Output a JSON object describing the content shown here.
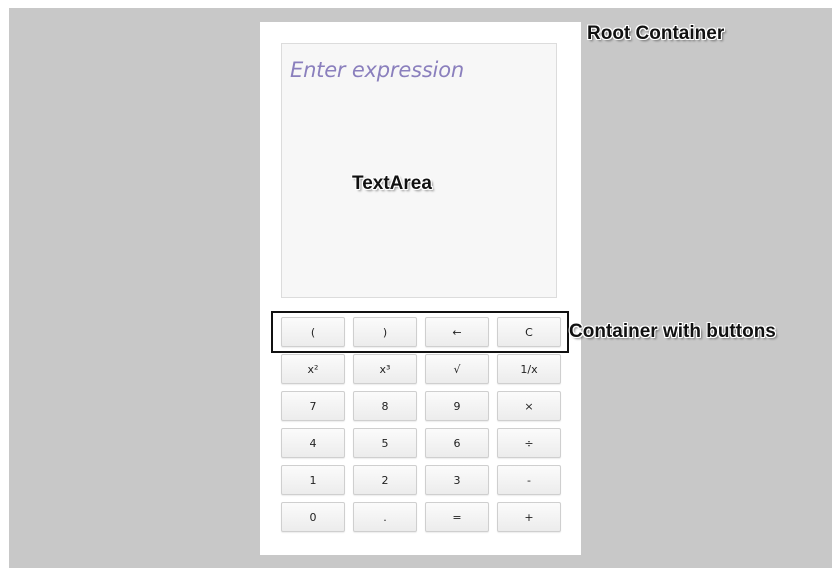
{
  "textarea": {
    "placeholder": "Enter expression"
  },
  "annotations": {
    "root_container": "Root Container",
    "text_area": "TextArea",
    "container_with_buttons": "Container with buttons"
  },
  "keypad": {
    "keys": [
      {
        "label": "(",
        "name": "key-open-paren"
      },
      {
        "label": ")",
        "name": "key-close-paren"
      },
      {
        "label": "←",
        "name": "key-backspace"
      },
      {
        "label": "C",
        "name": "key-clear"
      },
      {
        "label": "x²",
        "name": "key-square"
      },
      {
        "label": "x³",
        "name": "key-cube"
      },
      {
        "label": "√",
        "name": "key-sqrt"
      },
      {
        "label": "1/x",
        "name": "key-reciprocal"
      },
      {
        "label": "7",
        "name": "key-7"
      },
      {
        "label": "8",
        "name": "key-8"
      },
      {
        "label": "9",
        "name": "key-9"
      },
      {
        "label": "×",
        "name": "key-multiply"
      },
      {
        "label": "4",
        "name": "key-4"
      },
      {
        "label": "5",
        "name": "key-5"
      },
      {
        "label": "6",
        "name": "key-6"
      },
      {
        "label": "÷",
        "name": "key-divide"
      },
      {
        "label": "1",
        "name": "key-1"
      },
      {
        "label": "2",
        "name": "key-2"
      },
      {
        "label": "3",
        "name": "key-3"
      },
      {
        "label": "-",
        "name": "key-subtract"
      },
      {
        "label": "0",
        "name": "key-0"
      },
      {
        "label": ".",
        "name": "key-decimal"
      },
      {
        "label": "=",
        "name": "key-equals"
      },
      {
        "label": "+",
        "name": "key-add"
      }
    ]
  }
}
